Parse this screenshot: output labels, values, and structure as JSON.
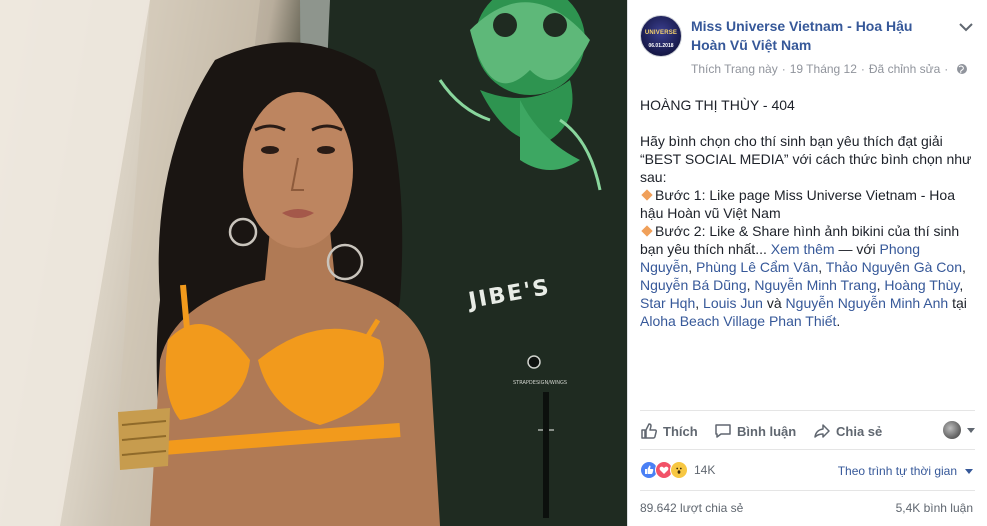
{
  "photo": {
    "board_text": "JIBE'S",
    "board_label": "STRAPDESIGN/WINGS"
  },
  "post": {
    "page_name": "Miss Universe Vietnam - Hoa Hậu Hoàn Vũ Việt Nam",
    "avatar_text": "UNIVERSE",
    "avatar_date": "06.01.2018",
    "like_page": "Thích Trang này",
    "date": "19 Tháng 12",
    "edited": "Đã chỉnh sửa",
    "title_line": "HOÀNG THỊ THÙY - 404",
    "intro": "Hãy bình chọn cho thí sinh bạn yêu thích đạt giải “BEST SOCIAL MEDIA” với cách thức bình chọn như sau:",
    "step1": "Bước 1: Like page Miss Universe Vietnam - Hoa hậu Hoàn vũ Việt Nam",
    "step2": "Bước 2: Like & Share hình ảnh bikini của thí sinh bạn yêu thích nhất...",
    "see_more": "Xem thêm",
    "with_text": "— với",
    "tagged": [
      "Phong Nguyễn",
      "Phùng Lê Cẩm Vân",
      "Thảo Nguyên Gà Con",
      "Nguyễn Bá Dũng",
      "Nguyễn Minh Trang",
      "Hoàng Thùy",
      "Star Hqh",
      "Louis Jun",
      "Nguyễn Nguyễn Minh Anh"
    ],
    "and_text": "và",
    "at_text": "tại",
    "location": "Aloha Beach Village Phan Thiết"
  },
  "actions": {
    "like": "Thích",
    "comment": "Bình luận",
    "share": "Chia sẻ"
  },
  "stats": {
    "reactions_count": "14K",
    "sort_label": "Theo trình tự thời gian",
    "shares": "89.642 lượt chia sẻ",
    "comments": "5,4K bình luận"
  }
}
